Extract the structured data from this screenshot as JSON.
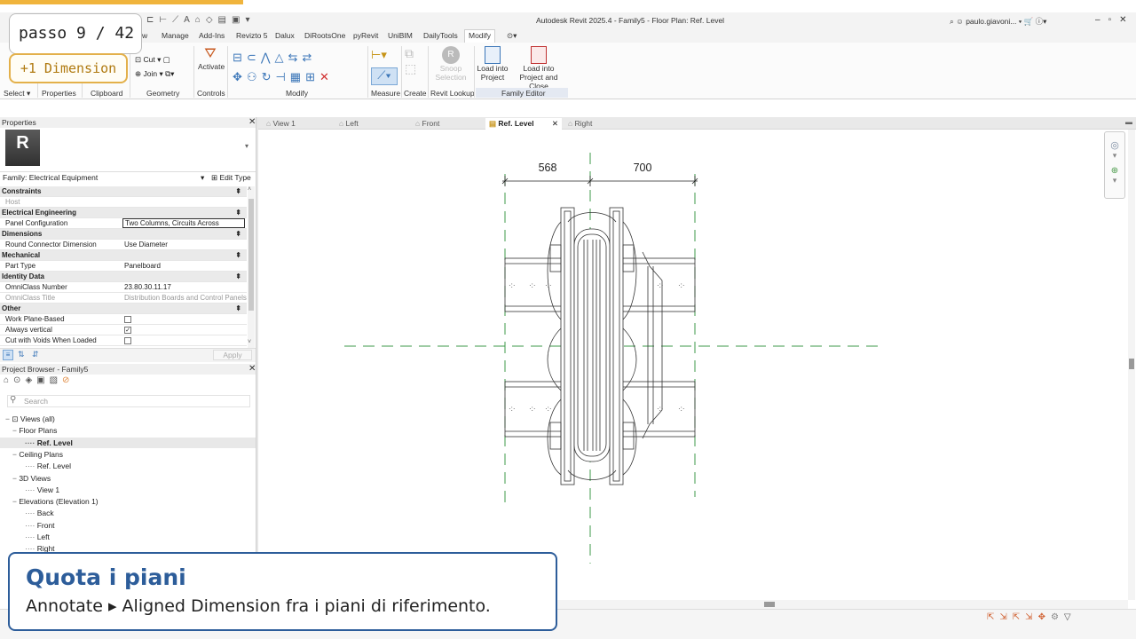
{
  "app": {
    "title": "Autodesk Revit 2025.4 - Family5 - Floor Plan: Ref. Level",
    "user": "paulo.giavoni...",
    "ribbon_tabs": [
      "w",
      "Manage",
      "Add-Ins",
      "Revizto 5",
      "Dalux",
      "DiRootsOne",
      "pyRevit",
      "UniBIM",
      "DailyTools",
      "Modify"
    ],
    "active_tab": "Modify"
  },
  "ribbon": {
    "select_label": "Select",
    "properties_label": "Properties",
    "clipboard_label": "Clipboard",
    "geometry_label": "Geometry",
    "controls_label": "Controls",
    "modify_label": "Modify",
    "measure_label": "Measure",
    "create_label": "Create",
    "revit_lookup_label": "Revit Lookup",
    "family_editor_label": "Family Editor",
    "cut_label": "Cut",
    "join_label": "Join",
    "activate_label": "Activate",
    "snoop_label": "Snoop\nSelection",
    "load_project_label": "Load into\nProject",
    "load_close_label": "Load into\nProject and Close"
  },
  "properties": {
    "header": "Properties",
    "family": "Family: Electrical Equipment",
    "edit_type": "Edit Type",
    "rows": [
      {
        "group": true,
        "k": "Constraints"
      },
      {
        "k": "Host",
        "v": "",
        "grey": true
      },
      {
        "group": true,
        "k": "Electrical Engineering"
      },
      {
        "k": "Panel Configuration",
        "v": "Two Columns, Circuits Across",
        "boxed": true
      },
      {
        "group": true,
        "k": "Dimensions"
      },
      {
        "k": "Round Connector Dimension",
        "v": "Use Diameter"
      },
      {
        "group": true,
        "k": "Mechanical"
      },
      {
        "k": "Part Type",
        "v": "Panelboard"
      },
      {
        "group": true,
        "k": "Identity Data"
      },
      {
        "k": "OmniClass Number",
        "v": "23.80.30.11.17"
      },
      {
        "k": "OmniClass Title",
        "v": "Distribution Boards and Control Panels",
        "grey": true
      },
      {
        "group": true,
        "k": "Other"
      },
      {
        "k": "Work Plane-Based",
        "check": false
      },
      {
        "k": "Always vertical",
        "check": true
      },
      {
        "k": "Cut with Voids When Loaded",
        "check": false
      }
    ],
    "apply": "Apply"
  },
  "browser": {
    "header": "Project Browser - Family5",
    "search_placeholder": "Search",
    "tree": [
      {
        "label": "Views (all)",
        "indent": 0
      },
      {
        "label": "Floor Plans",
        "indent": 1
      },
      {
        "label": "Ref. Level",
        "indent": 2,
        "selected": true
      },
      {
        "label": "Ceiling Plans",
        "indent": 1
      },
      {
        "label": "Ref. Level",
        "indent": 2
      },
      {
        "label": "3D Views",
        "indent": 1
      },
      {
        "label": "View 1",
        "indent": 2
      },
      {
        "label": "Elevations (Elevation 1)",
        "indent": 1
      },
      {
        "label": "Back",
        "indent": 2
      },
      {
        "label": "Front",
        "indent": 2
      },
      {
        "label": "Left",
        "indent": 2
      },
      {
        "label": "Right",
        "indent": 2
      }
    ]
  },
  "view_tabs": [
    {
      "label": "View 1"
    },
    {
      "label": "Left"
    },
    {
      "label": "Front"
    },
    {
      "label": "Ref. Level",
      "active": true
    },
    {
      "label": "Right"
    }
  ],
  "drawing": {
    "dim_left": "568",
    "dim_right": "700"
  },
  "overlay": {
    "step": "passo 9 / 42",
    "badge": "+1 Dimension",
    "callout_title": "Quota i piani",
    "callout_body": "Annotate ▸ Aligned Dimension fra i piani di riferimento."
  },
  "colors": {
    "accent": "#2d5d9a",
    "badge": "#e3b04a",
    "ref_plane": "#3c9a4a"
  }
}
